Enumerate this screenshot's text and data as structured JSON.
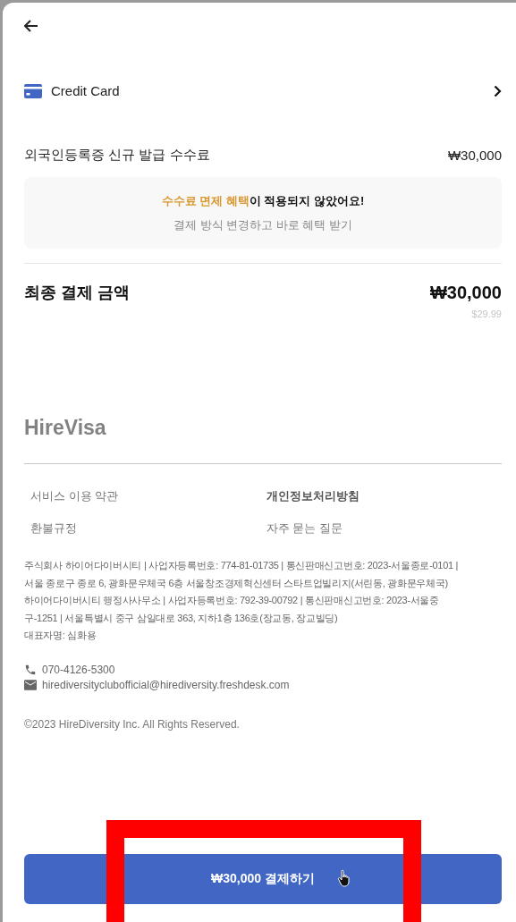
{
  "payment_method": {
    "label": "Credit Card"
  },
  "fee": {
    "label": "외국인등록증 신규 발급 수수료",
    "amount": "₩30,000"
  },
  "notice": {
    "headline": "**수수료 면제 혜택**이 적용되지 않았어요!",
    "subtext": "결제 방식 변경하고 바로 혜택 받기"
  },
  "total": {
    "label": "최종 결제 금액",
    "amount": "₩30,000",
    "converted": "$29.99"
  },
  "footer": {
    "logo": "HireVisa",
    "links": [
      {
        "label": "서비스 이용 약관",
        "emphasized": false
      },
      {
        "label": "개인정보처리방침",
        "emphasized": true
      },
      {
        "label": "환불규정",
        "emphasized": false
      },
      {
        "label": "자주 묻는 질문",
        "emphasized": false
      }
    ],
    "company_lines": [
      "주식회사 하이어다이버시티 | 사업자등록번호: 774-81-01735 | 통신판매신고번호: 2023-서울종로-0101 |",
      "서울 종로구 종로 6, 광화문우체국 6층 서울창조경제혁신센터 스타트업빌리지(서린동, 광화문우체국)",
      "하이어다이버시티 행정사사무소 | 사업자등록번호: 792-39-00792 | 통신판매신고번호: 2023-서울중",
      "구-1251 | 서울특별시 중구 삼일대로 363, 지하1층 136호(장교동, 장교빌딩)",
      "대표자명: 심화용"
    ],
    "contacts": [
      {
        "kind": "phone",
        "text": "070-4126-5300"
      },
      {
        "kind": "email",
        "text": "hirediversityclubofficial@hirediversity.freshdesk.com"
      }
    ],
    "copyright": "©2023 HireDiversity Inc. All Rights Reserved."
  },
  "pay_button": {
    "label": "₩30,000 결제하기"
  }
}
